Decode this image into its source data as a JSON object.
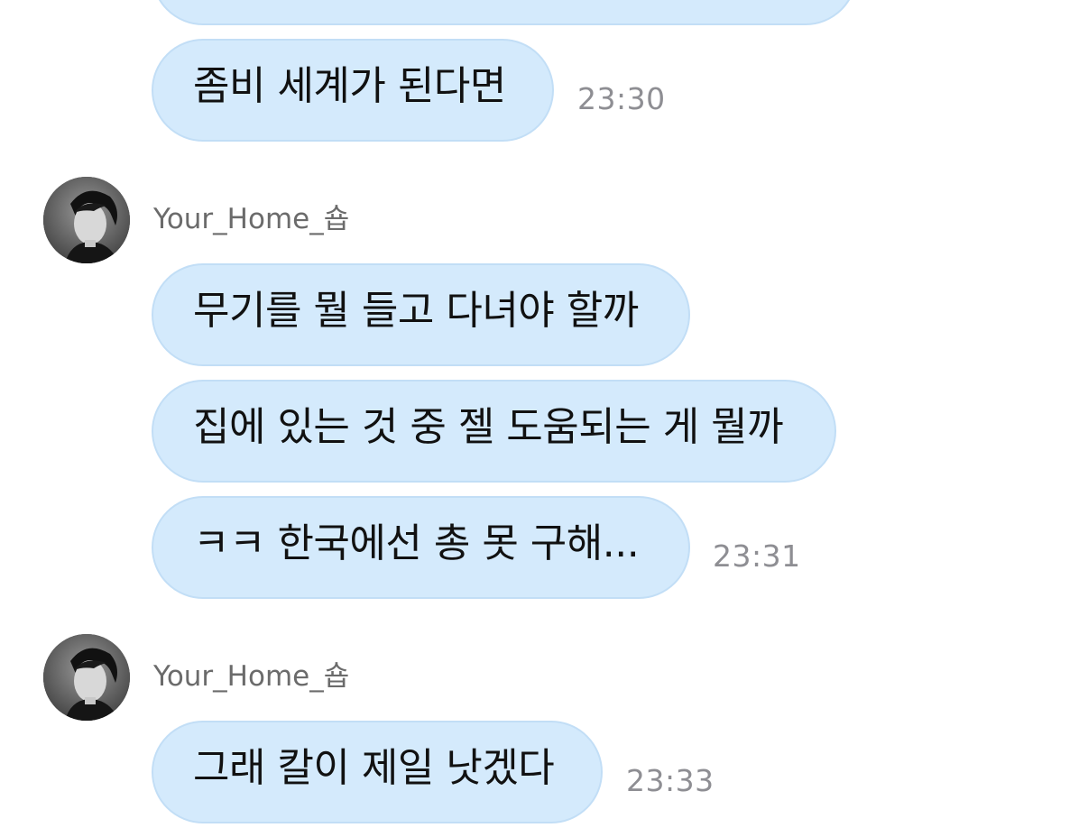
{
  "messages_top": {
    "partial_bubble": "",
    "msg1": {
      "text": "좀비 세계가 된다면",
      "time": "23:30"
    }
  },
  "group1": {
    "sender": "Your_Home_숍",
    "msg1": {
      "text": "무기를 뭘 들고 다녀야 할까"
    },
    "msg2": {
      "text": "집에 있는 것 중 젤 도움되는 게 뭘까"
    },
    "msg3": {
      "text": "ㅋㅋ 한국에선 총 못 구해...",
      "time": "23:31"
    }
  },
  "group2": {
    "sender": "Your_Home_숍",
    "msg1": {
      "text": "그래 칼이 제일 낫겠다",
      "time": "23:33"
    }
  },
  "colors": {
    "bubble": "#d4eafc",
    "bubble_border": "#c2def6",
    "timestamp": "#8e8e93",
    "sender": "#6b6b6b"
  },
  "icons": {
    "avatar": "profile-photo-avatar"
  }
}
